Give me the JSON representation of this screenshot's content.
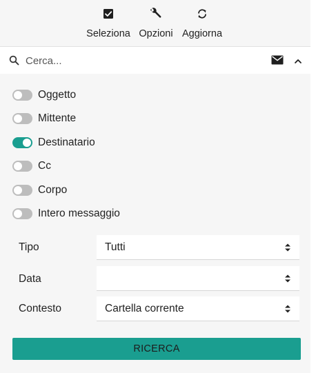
{
  "toolbar": {
    "items": [
      {
        "label": "Seleziona",
        "icon": "checkbox-icon"
      },
      {
        "label": "Opzioni",
        "icon": "wrench-icon"
      },
      {
        "label": "Aggiorna",
        "icon": "refresh-icon"
      }
    ]
  },
  "search": {
    "placeholder": "Cerca...",
    "value": ""
  },
  "filters": [
    {
      "label": "Oggetto",
      "on": false
    },
    {
      "label": "Mittente",
      "on": false
    },
    {
      "label": "Destinatario",
      "on": true
    },
    {
      "label": "Cc",
      "on": false
    },
    {
      "label": "Corpo",
      "on": false
    },
    {
      "label": "Intero messaggio",
      "on": false
    }
  ],
  "form": {
    "tipo": {
      "label": "Tipo",
      "value": "Tutti"
    },
    "data": {
      "label": "Data",
      "value": ""
    },
    "contesto": {
      "label": "Contesto",
      "value": "Cartella corrente"
    }
  },
  "button": {
    "label": "RICERCA"
  },
  "colors": {
    "accent": "#1a9e90",
    "toggle_off": "#bdbdbd",
    "background": "#f6f6f6"
  }
}
